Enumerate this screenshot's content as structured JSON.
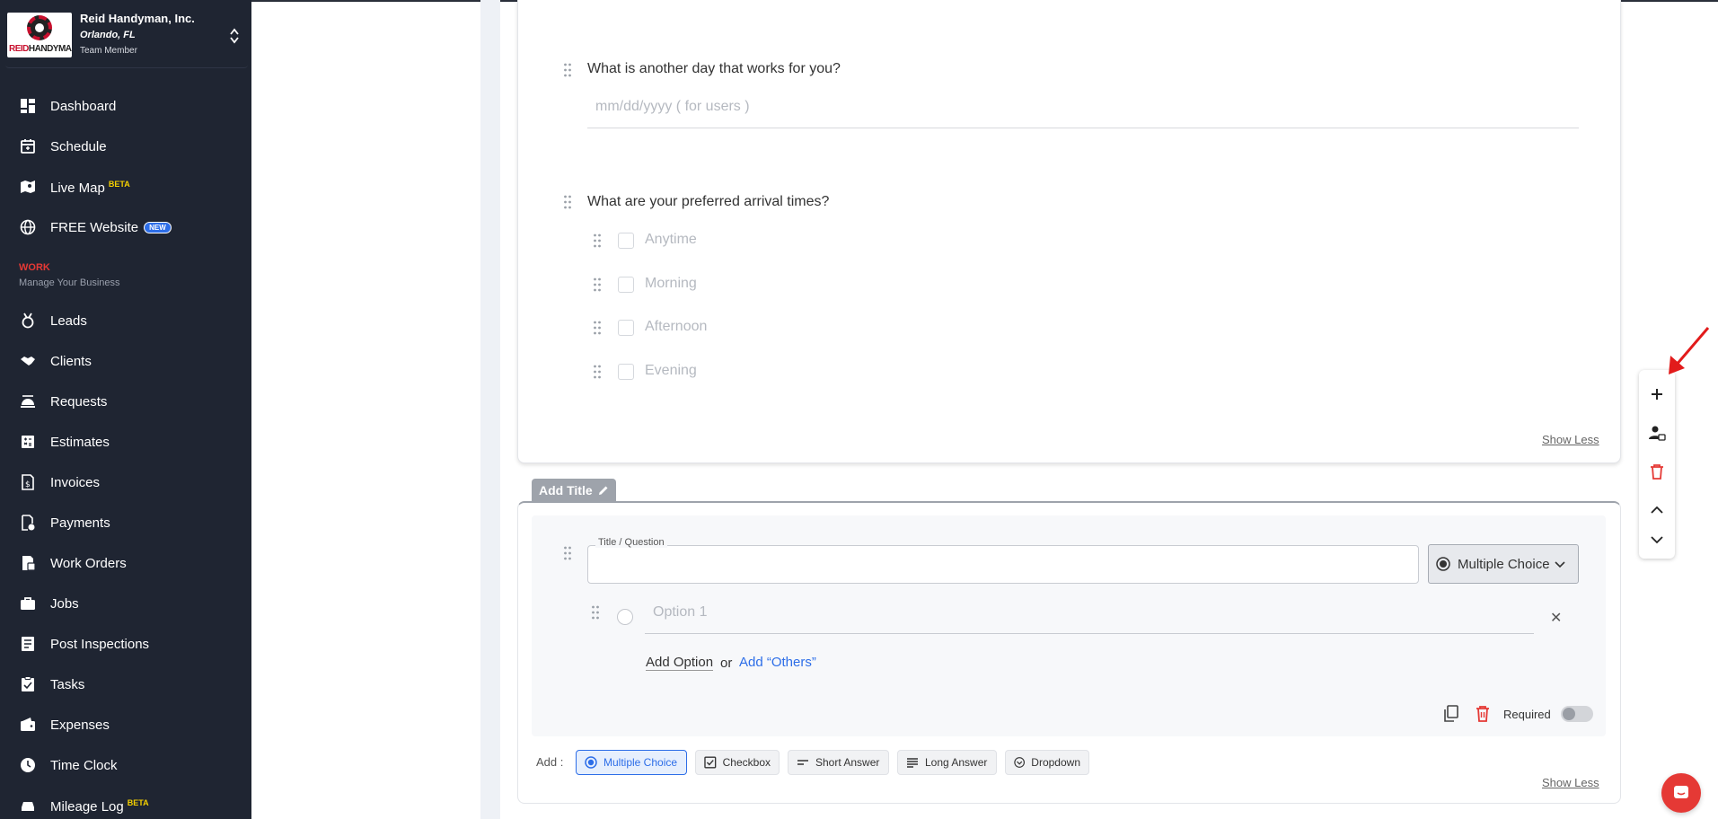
{
  "company": {
    "name": "Reid Handyman, Inc.",
    "city": "Orlando, FL",
    "role": "Team Member",
    "logo_text_a": "REID",
    "logo_text_b": "HANDYMAN"
  },
  "nav": {
    "dashboard": "Dashboard",
    "schedule": "Schedule",
    "live_map": "Live Map",
    "live_map_badge": "BETA",
    "free_website": "FREE Website",
    "free_website_badge": "NEW",
    "section_title": "WORK",
    "section_subtitle": "Manage Your Business",
    "leads": "Leads",
    "clients": "Clients",
    "requests": "Requests",
    "estimates": "Estimates",
    "invoices": "Invoices",
    "payments": "Payments",
    "work_orders": "Work Orders",
    "jobs": "Jobs",
    "post_inspections": "Post Inspections",
    "tasks": "Tasks",
    "expenses": "Expenses",
    "time_clock": "Time Clock",
    "mileage_log": "Mileage Log",
    "mileage_log_badge": "BETA"
  },
  "form": {
    "q1": {
      "text": "What is another day that works for you?",
      "placeholder": "mm/dd/yyyy ( for users )"
    },
    "q2": {
      "text": "What are your preferred arrival times?",
      "options": [
        "Anytime",
        "Morning",
        "Afternoon",
        "Evening"
      ]
    },
    "show_less": "Show Less",
    "add_title": "Add Title",
    "new_question": {
      "field_label": "Title / Question",
      "type_selected": "Multiple Choice",
      "option_placeholder": "Option 1",
      "add_option": "Add Option",
      "or": "or",
      "add_others": "Add “Others”",
      "required_label": "Required"
    },
    "add_bar": {
      "label": "Add :",
      "multiple_choice": "Multiple Choice",
      "checkbox": "Checkbox",
      "short_answer": "Short Answer",
      "long_answer": "Long Answer",
      "dropdown": "Dropdown"
    },
    "show_less_bottom": "Show Less"
  },
  "colors": {
    "sidebar_bg": "#1f2532",
    "accent": "#2d6ee8",
    "danger": "#e53935",
    "badge_beta": "#f5d000"
  }
}
